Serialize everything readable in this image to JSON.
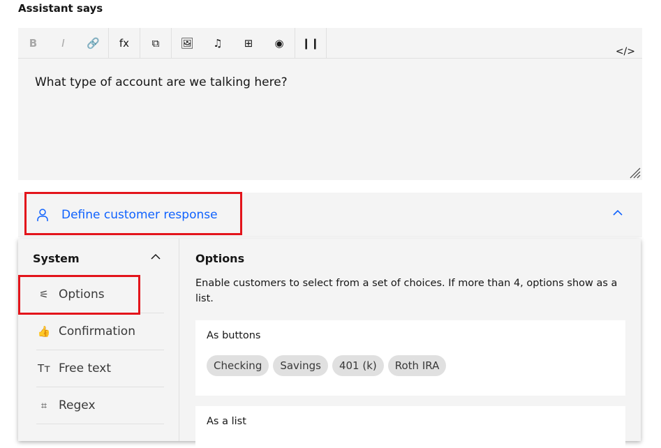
{
  "title": "Assistant says",
  "editor": {
    "toolbar": [
      {
        "icon": "bold-icon",
        "glyph": "B",
        "disabled": true
      },
      {
        "icon": "italic-icon",
        "glyph": "I",
        "disabled": true
      },
      {
        "icon": "link-icon",
        "glyph": "🔗",
        "disabled": true
      },
      {
        "sep": true
      },
      {
        "icon": "function-icon",
        "glyph": "fx"
      },
      {
        "sep": true
      },
      {
        "icon": "variable-icon",
        "glyph": "⧉"
      },
      {
        "sep": true
      },
      {
        "icon": "image-icon",
        "glyph": "🖼"
      },
      {
        "icon": "audio-icon",
        "glyph": "♫"
      },
      {
        "icon": "video-icon",
        "glyph": "⊞"
      },
      {
        "icon": "iframe-icon",
        "glyph": "◉"
      },
      {
        "sep": true
      },
      {
        "icon": "pause-icon",
        "glyph": "❙❙"
      },
      {
        "sep": true
      }
    ],
    "code_glyph": "</>",
    "text": "What type of account are we talking here?"
  },
  "define_response": {
    "label": "Define customer response"
  },
  "panel": {
    "section": "System",
    "items": [
      {
        "label": "Options",
        "icon": "options-icon",
        "glyph": "⚟"
      },
      {
        "label": "Confirmation",
        "icon": "thumbs-up-icon",
        "glyph": "👍"
      },
      {
        "label": "Free text",
        "icon": "text-icon",
        "glyph": "Tт"
      },
      {
        "label": "Regex",
        "icon": "regex-icon",
        "glyph": "⌗"
      }
    ],
    "options_title": "Options",
    "options_desc": "Enable customers to select from a set of choices. If more than 4, options show as a list.",
    "as_buttons": "As buttons",
    "chips": [
      "Checking",
      "Savings",
      "401 (k)",
      "Roth IRA"
    ],
    "as_list": "As a list"
  },
  "colors": {
    "accent": "#0f62fe",
    "highlight": "#e3141b"
  }
}
